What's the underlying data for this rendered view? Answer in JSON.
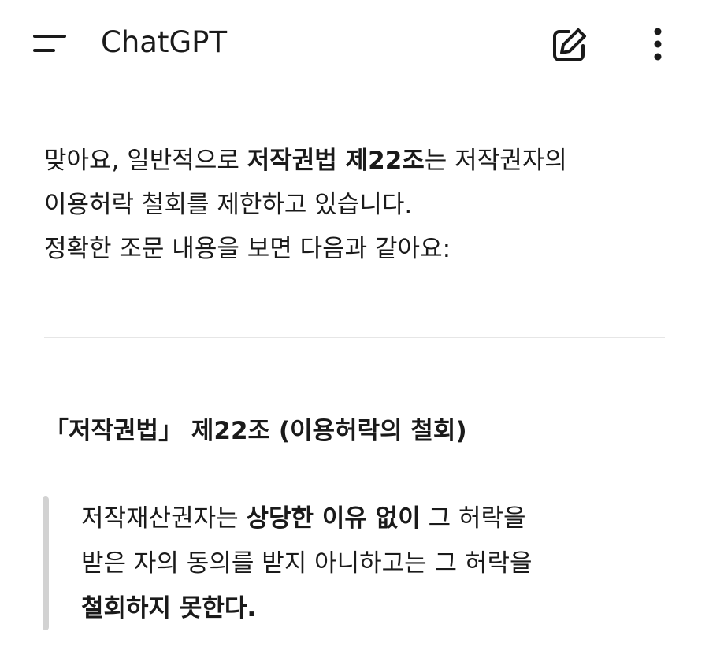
{
  "header": {
    "title": "ChatGPT",
    "menu_icon": "hamburger-menu-icon",
    "new_chat_icon": "edit-pencil-icon",
    "more_icon": "more-vertical-icon"
  },
  "message": {
    "line1_a": "맞아요, 일반적으로 ",
    "line1_b": "저작권법 제22조",
    "line1_c": "는 저작권자의",
    "line2": "이용허락 철회를 제한하고 있습니다.",
    "line3": "정확한 조문 내용을 보면 다음과 같아요:"
  },
  "heading": "「저작권법」 제22조 (이용허락의 철회)",
  "quote": {
    "line1_a": "저작재산권자는 ",
    "line1_b": "상당한 이유 없이",
    "line1_c": " 그 허락을",
    "line2": "받은 자의 동의를 받지 아니하고는 그 허락을",
    "line3": "철회하지 못한다."
  }
}
